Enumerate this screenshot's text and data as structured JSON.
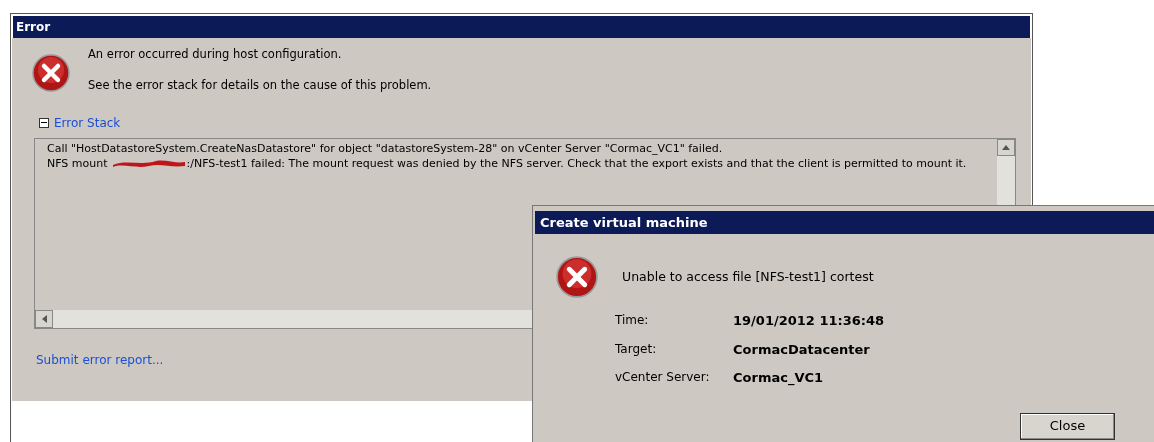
{
  "error_window": {
    "title": "Error",
    "messages": [
      "An error occurred during host configuration.",
      "See the error stack for details on the cause of this problem."
    ],
    "error_stack": {
      "label": "Error Stack",
      "expanded": true,
      "lines": [
        {
          "text": "Call \"HostDatastoreSystem.CreateNasDatastore\" for object \"datastoreSystem-28\" on vCenter Server \"Cormac_VC1\" failed.",
          "redacted": false
        },
        {
          "text": "NFS mount",
          "redacted": true,
          "suffix": ":/NFS-test1 failed: The mount request was denied by the NFS server. Check that the export exists and that the client is permitted to mount it."
        }
      ]
    },
    "link": "Submit error report..."
  },
  "vm_dialog": {
    "title": "Create virtual machine",
    "message": "Unable to access file [NFS-test1] cortest",
    "details": [
      {
        "label": "Time:",
        "value": "19/01/2012 11:36:48"
      },
      {
        "label": "Target:",
        "value": "CormacDatacenter"
      },
      {
        "label": "vCenter Server:",
        "value": "Cormac_VC1"
      }
    ],
    "button": "Close"
  }
}
